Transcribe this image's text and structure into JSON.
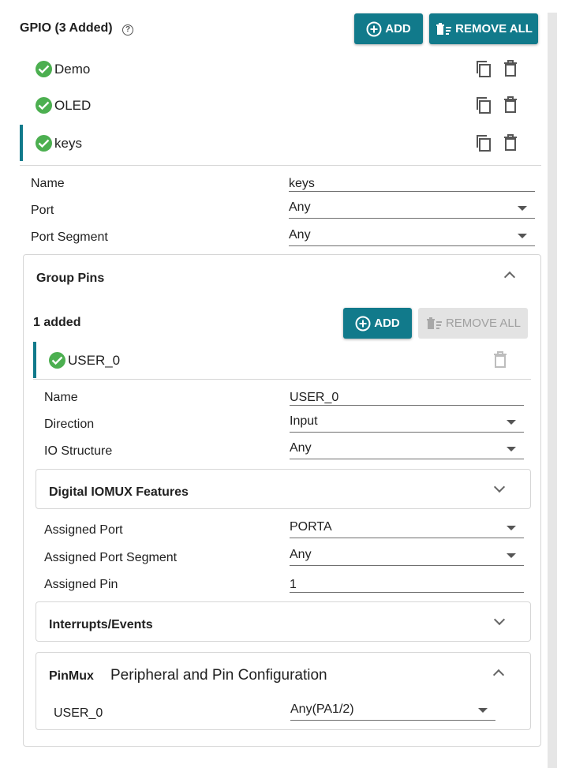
{
  "gpio": {
    "title": "GPIO (3 Added)",
    "help_icon": "?",
    "add_label": "ADD",
    "remove_all_label": "REMOVE ALL",
    "items": [
      {
        "label": "Demo"
      },
      {
        "label": "OLED"
      },
      {
        "label": "keys"
      }
    ],
    "fields": {
      "name_label": "Name",
      "name_value": "keys",
      "port_label": "Port",
      "port_value": "Any",
      "port_segment_label": "Port Segment",
      "port_segment_value": "Any"
    }
  },
  "group_pins": {
    "title": "Group Pins",
    "added_count": "1 added",
    "add_label": "ADD",
    "remove_all_label": "REMOVE ALL",
    "pin": {
      "label": "USER_0"
    },
    "fields": {
      "name_label": "Name",
      "name_value": "USER_0",
      "direction_label": "Direction",
      "direction_value": "Input",
      "io_structure_label": "IO Structure",
      "io_structure_value": "Any"
    },
    "digital_iomux": {
      "title": "Digital IOMUX Features",
      "assigned_port_label": "Assigned Port",
      "assigned_port_value": "PORTA",
      "assigned_port_segment_label": "Assigned Port Segment",
      "assigned_port_segment_value": "Any",
      "assigned_pin_label": "Assigned Pin",
      "assigned_pin_value": "1"
    },
    "interrupts": {
      "title": "Interrupts/Events"
    },
    "pinmux": {
      "title": "PinMux",
      "subtitle": "Peripheral and Pin Configuration",
      "pin_label": "USER_0",
      "pin_value": "Any(PA1/2)"
    }
  },
  "colors": {
    "accent": "#117a8b",
    "success": "#4caf50"
  }
}
